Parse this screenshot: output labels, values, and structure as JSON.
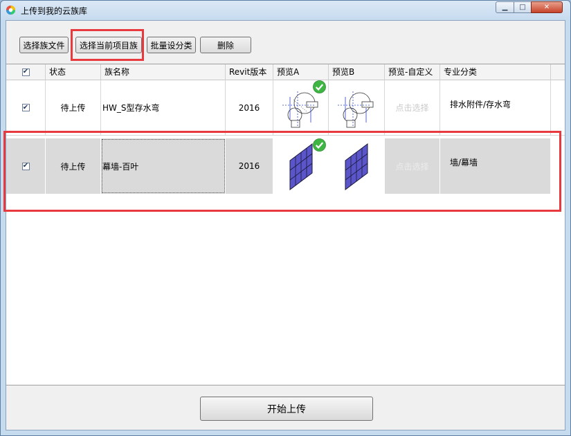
{
  "window": {
    "title": "上传到我的云族库",
    "buttons": {
      "minimize": "▁",
      "maximize": "□",
      "close": "✕"
    }
  },
  "toolbar": {
    "select_family_file": "选择族文件",
    "select_project_family": "选择当前项目族",
    "batch_category": "批量设分类",
    "delete": "删除"
  },
  "table": {
    "columns": [
      "状态",
      "族名称",
      "Revit版本",
      "预览A",
      "预览B",
      "预览-自定义",
      "专业分类"
    ],
    "header_checked": true,
    "rows": [
      {
        "checked": true,
        "status": "待上传",
        "name": "HW_S型存水弯",
        "version": "2016",
        "custom": "点击选择",
        "category": "排水附件/存水弯",
        "previewA_ok": true
      },
      {
        "checked": true,
        "status": "待上传",
        "name": "幕墙-百叶",
        "version": "2016",
        "custom": "点击选择",
        "category": "墙/幕墙",
        "previewA_ok": true
      }
    ]
  },
  "footer": {
    "start_upload": "开始上传"
  },
  "colors": {
    "highlight": "#e8393f",
    "selected_row": "#dadada",
    "panel_blue": "#5a55c8"
  },
  "icons": {
    "app": "app-logo-icon",
    "check": "checkmark-icon",
    "ok_badge": "green-check-badge-icon"
  }
}
